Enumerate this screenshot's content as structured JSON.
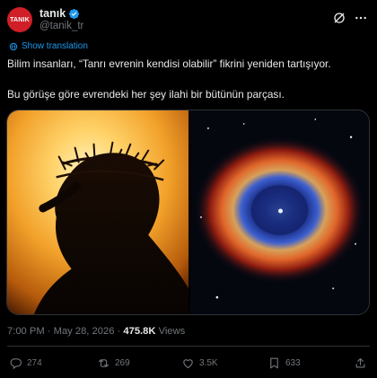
{
  "author": {
    "display_name": "tanık",
    "handle": "@tanik_tr",
    "avatar_text": "TANIK",
    "avatar_color": "#d01f26",
    "verified": true
  },
  "translate_label": "Show translation",
  "post": {
    "line1": "Bilim insanları, “Tanrı evrenin kendisi olabilir” fikrini yeniden tartışıyor.",
    "line2": "Bu görüşe göre evrendeki her şey ilahi bir bütünün parçası."
  },
  "media": [
    {
      "name": "crown-of-thorns-image",
      "icon": "photo"
    },
    {
      "name": "helix-nebula-image",
      "icon": "photo"
    }
  ],
  "meta": {
    "time": "7:00 PM",
    "separator": "·",
    "date": "May 28, 2026",
    "views_count": "475.8K",
    "views_label": "Views"
  },
  "actions": {
    "replies": "274",
    "reposts": "269",
    "likes": "3.5K",
    "bookmarks": "633"
  },
  "colors": {
    "background": "#000000",
    "text": "#e7e9ea",
    "muted": "#71767b",
    "link": "#1d9bf0",
    "border": "#2f3336"
  }
}
